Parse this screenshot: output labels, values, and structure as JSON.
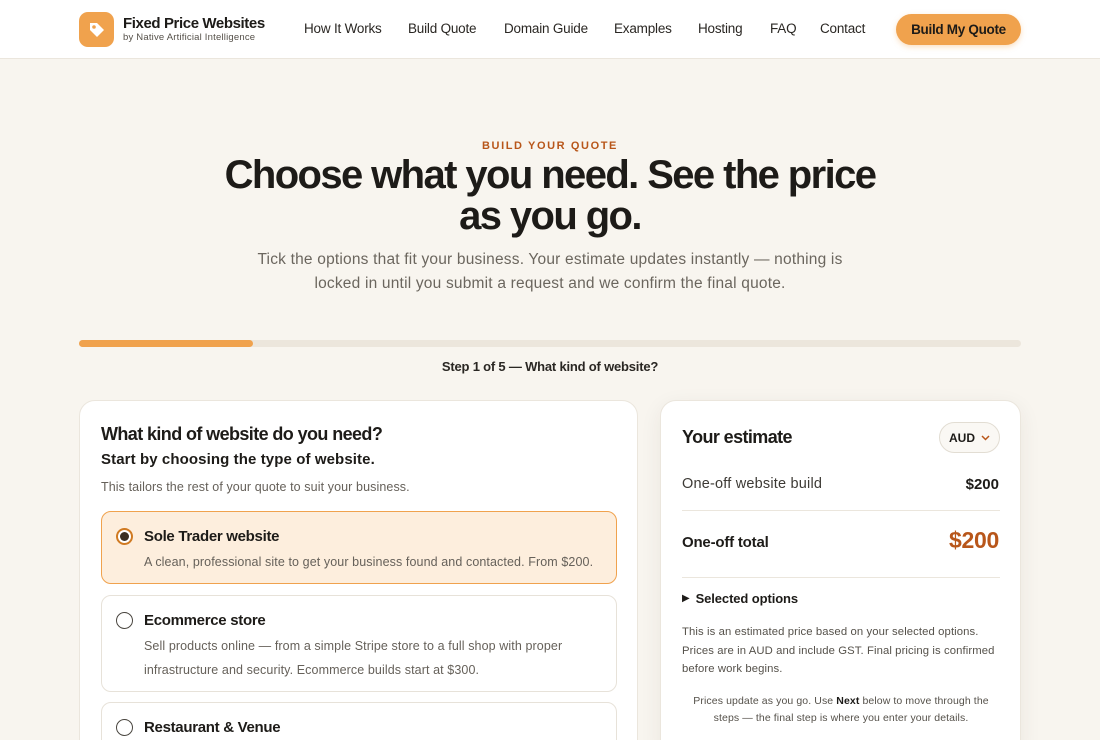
{
  "header": {
    "brand_name": "Fixed Price Websites",
    "brand_sub": "by Native Artificial Intelligence",
    "nav": [
      "How It Works",
      "Build Quote",
      "Domain Guide",
      "Examples",
      "Hosting",
      "FAQ",
      "Contact"
    ],
    "cta": "Build My Quote"
  },
  "hero": {
    "eyebrow": "BUILD YOUR QUOTE",
    "title": "Choose what you need. See the price as you go.",
    "lead": "Tick the options that fit your business. Your estimate updates instantly — nothing is locked in until you submit a request and we confirm the final quote."
  },
  "progress": {
    "fraction": 0.185,
    "step_label": "Step 1 of 5 — What kind of website?"
  },
  "question": {
    "title": "What kind of website do you need?",
    "subtitle": "Start by choosing the type of website.",
    "help": "This tailors the rest of your quote to suit your business.",
    "options": [
      {
        "name": "Sole Trader website",
        "desc": "A clean, professional site to get your business found and contacted. From $200.",
        "selected": true
      },
      {
        "name": "Ecommerce store",
        "desc": "Sell products online — from a simple Stripe store to a full shop with proper infrastructure and security. Ecommerce builds start at $300.",
        "selected": false
      },
      {
        "name": "Restaurant & Venue",
        "desc": "",
        "selected": false
      }
    ]
  },
  "estimate": {
    "title": "Your estimate",
    "currency": "AUD",
    "build_label": "One-off website build",
    "build_value": "$200",
    "total_label": "One-off total",
    "total_value": "$200",
    "selected_options": "Selected options",
    "note": "This is an estimated price based on your selected options. Prices are in AUD and include GST. Final pricing is confirmed before work begins.",
    "foot_pre": "Prices update as you go. Use ",
    "foot_bold": "Next",
    "foot_post": " below to move through the steps — the final step is where you enter your details."
  },
  "colors": {
    "accent": "#f0a24d",
    "accent_dark": "#b8561a",
    "background": "#f8f5ef"
  }
}
